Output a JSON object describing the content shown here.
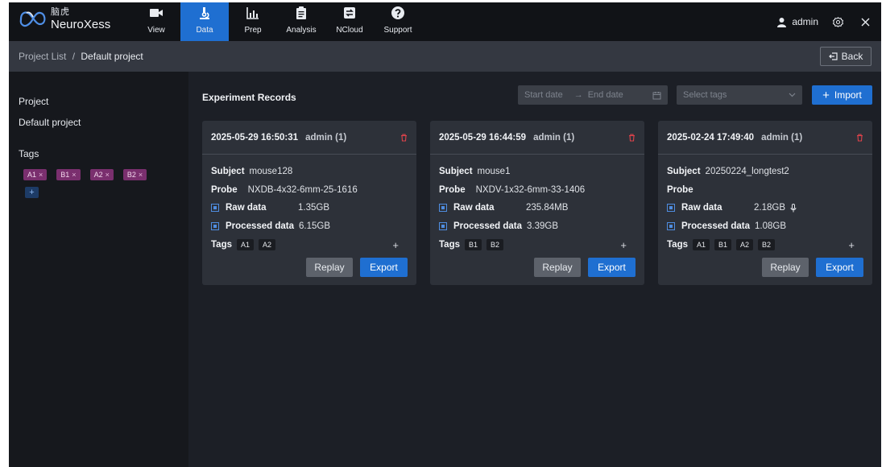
{
  "brand": {
    "cn": "脑虎",
    "en": "NeuroXess"
  },
  "nav": [
    {
      "label": "View",
      "icon": "video-icon"
    },
    {
      "label": "Data",
      "icon": "microscope-icon",
      "active": true
    },
    {
      "label": "Prep",
      "icon": "bar-chart-icon"
    },
    {
      "label": "Analysis",
      "icon": "clipboard-icon"
    },
    {
      "label": "NCloud",
      "icon": "cloud-sync-icon"
    },
    {
      "label": "Support",
      "icon": "help-icon"
    }
  ],
  "user": {
    "name": "admin"
  },
  "breadcrumb": {
    "parent": "Project List",
    "separator": "/",
    "current": "Default project"
  },
  "back_label": "Back",
  "sidebar": {
    "project_label": "Project",
    "project_value": "Default project",
    "tags_label": "Tags",
    "tags": [
      "A1",
      "B1",
      "A2",
      "B2"
    ],
    "tag_remove": "×",
    "add_tag": "+"
  },
  "main": {
    "title": "Experiment Records",
    "start_placeholder": "Start date",
    "end_placeholder": "End date",
    "date_arrow": "→",
    "tags_placeholder": "Select tags",
    "import_label": "Import",
    "import_plus": "+"
  },
  "labels": {
    "subject": "Subject",
    "probe": "Probe",
    "raw": "Raw data",
    "processed": "Processed data",
    "tags": "Tags",
    "add": "+",
    "replay": "Replay",
    "export": "Export"
  },
  "records": [
    {
      "datetime": "2025-05-29 16:50:31",
      "owner": "admin (1)",
      "subject": "mouse128",
      "probe": "NXDB-4x32-6mm-25-1616",
      "raw": "1.35GB",
      "processed": "6.15GB",
      "tags": [
        "A1",
        "A2"
      ],
      "has_audio": false
    },
    {
      "datetime": "2025-05-29 16:44:59",
      "owner": "admin (1)",
      "subject": "mouse1",
      "probe": "NXDV-1x32-6mm-33-1406",
      "raw": "235.84MB",
      "processed": "3.39GB",
      "tags": [
        "B1",
        "B2"
      ],
      "has_audio": false
    },
    {
      "datetime": "2025-02-24 17:49:40",
      "owner": "admin (1)",
      "subject": "20250224_longtest2",
      "probe": "",
      "raw": "2.18GB",
      "processed": "1.08GB",
      "tags": [
        "A1",
        "B1",
        "A2",
        "B2"
      ],
      "has_audio": true
    }
  ],
  "colors": {
    "accent": "#1f6fd1",
    "danger": "#e0434b",
    "tag": "#7a2f6e",
    "card": "#2d3139",
    "sidebar": "#16181d"
  }
}
